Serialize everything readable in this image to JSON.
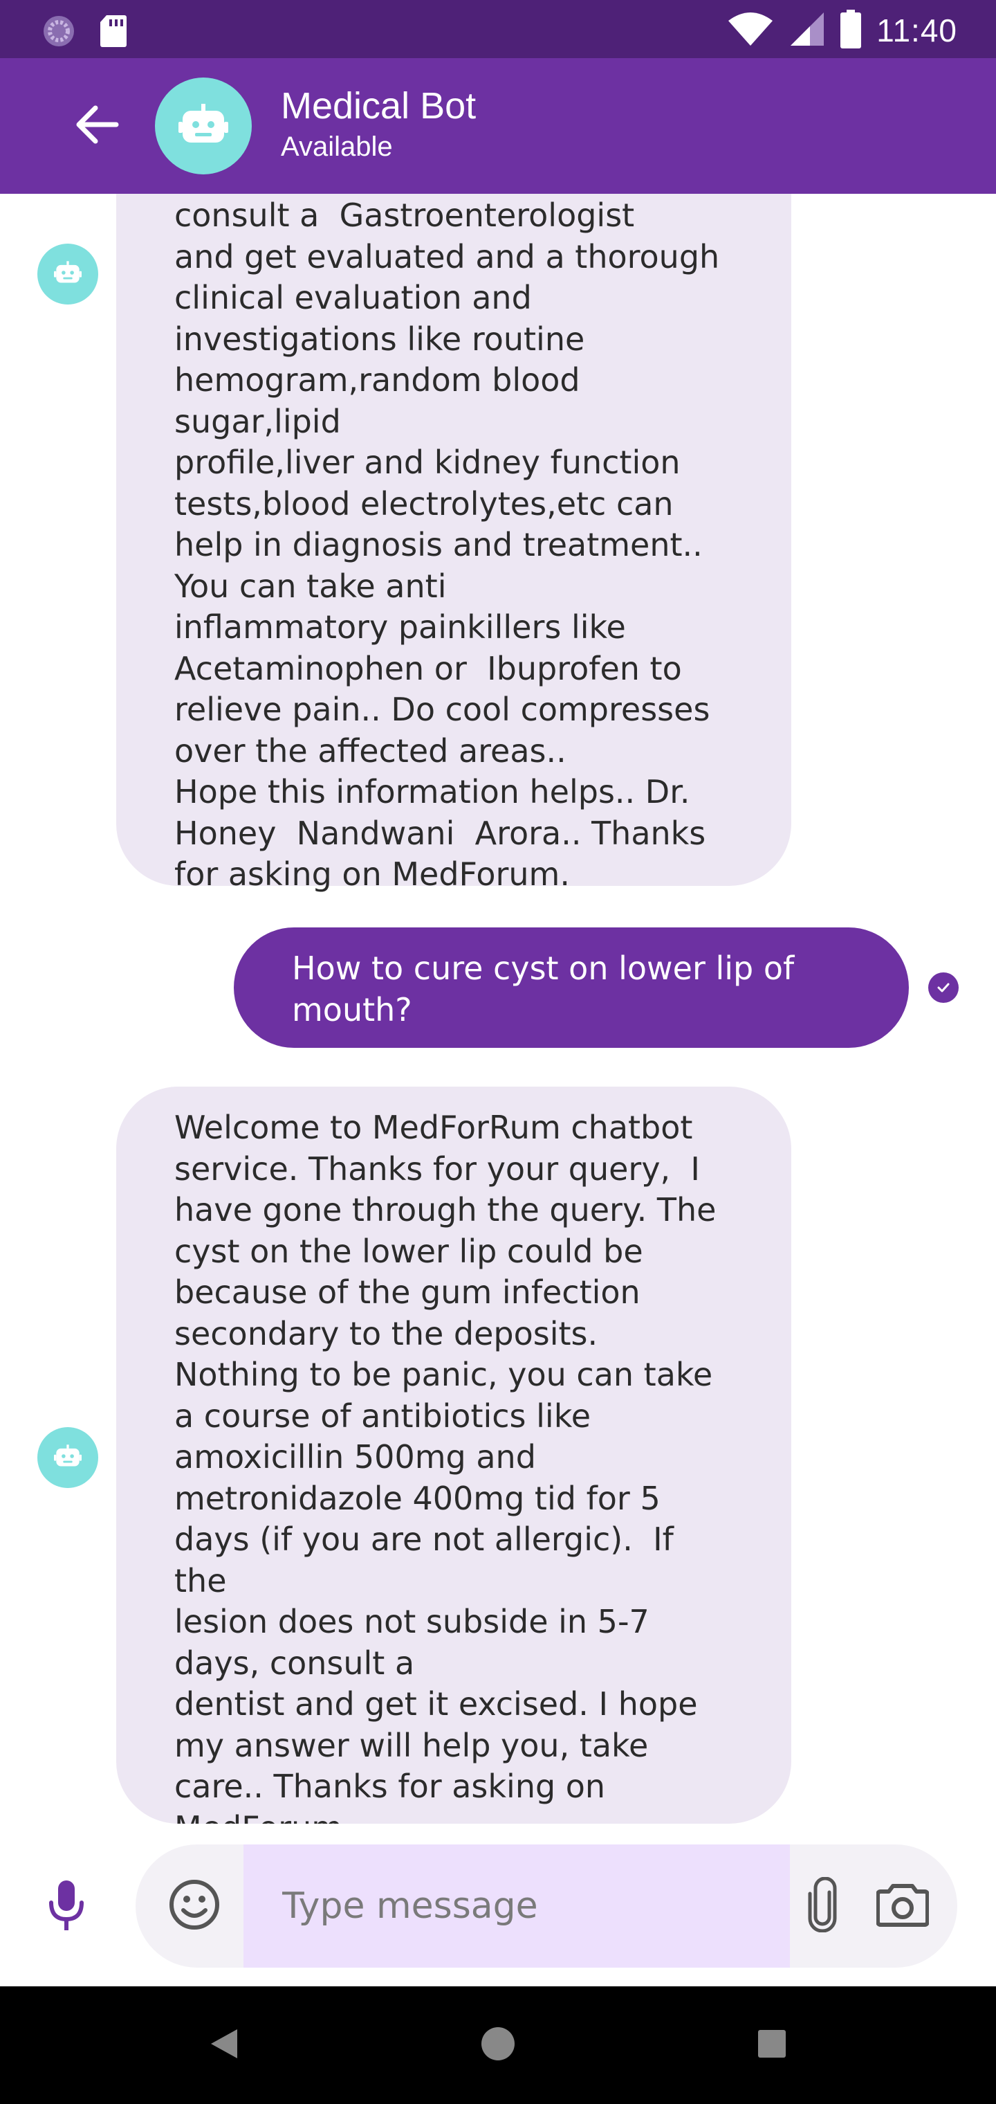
{
  "status_bar": {
    "time": "11:40",
    "left_icons": [
      "sync-icon",
      "sd-card-icon"
    ],
    "right_icons": [
      "wifi-icon",
      "cellular-signal-icon",
      "battery-icon"
    ]
  },
  "header": {
    "bot_name": "Medical Bot",
    "bot_status": "Available",
    "back_icon": "arrow-back-icon",
    "avatar_icon": "robot-icon"
  },
  "messages": [
    {
      "sender": "bot",
      "text": "consult a  Gastroenterologist\nand get evaluated and a thorough\nclinical evaluation and\ninvestigations like routine\nhemogram,random blood\nsugar,lipid\nprofile,liver and kidney function\ntests,blood electrolytes,etc can\nhelp in diagnosis and treatment..\nYou can take anti\ninflammatory painkillers like\nAcetaminophen or  Ibuprofen to\nrelieve pain.. Do cool compresses\nover the affected areas..\nHope this information helps.. Dr.\nHoney  Nandwani  Arora.. Thanks\nfor asking on MedForum."
    },
    {
      "sender": "user",
      "text": "How to cure cyst on lower lip of\nmouth?",
      "status_icon": "read-check-icon"
    },
    {
      "sender": "bot",
      "text": "Welcome to MedForRum chatbot\nservice. Thanks for your query,  I\nhave gone through the query. The\ncyst on the lower lip could be\nbecause of the gum infection\nsecondary to the deposits.\nNothing to be panic, you can take\na course of antibiotics like\namoxicillin 500mg and\nmetronidazole 400mg tid for 5\ndays (if you are not allergic).  If the\nlesion does not subside in 5-7\ndays, consult a\ndentist and get it excised. I hope\nmy answer will help you, take\ncare.. Thanks for asking on\nMedForum."
    }
  ],
  "composer": {
    "placeholder": "Type message",
    "value": "",
    "icons": [
      "microphone-icon",
      "emoji-icon",
      "attach-icon",
      "camera-icon"
    ]
  },
  "nav_bar": {
    "icons": [
      "nav-back-icon",
      "nav-home-icon",
      "nav-recents-icon"
    ]
  },
  "colors": {
    "status_bar": "#4e2177",
    "app_bar": "#6d31a2",
    "accent": "#6d31a2",
    "avatar": "#7fe0de",
    "bot_bubble": "#ede7f3",
    "input_highlight": "#ede0fd"
  }
}
